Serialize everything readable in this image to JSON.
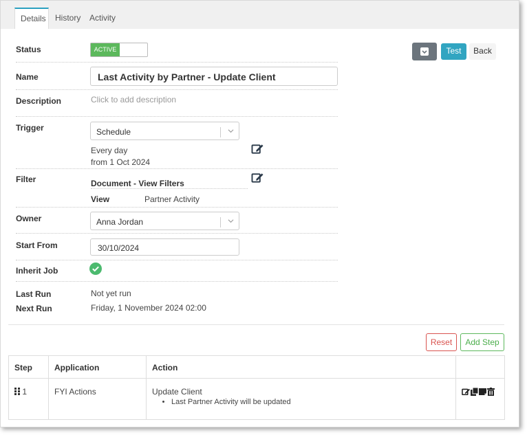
{
  "tabs": [
    {
      "label": "Details"
    },
    {
      "label": "History"
    },
    {
      "label": "Activity"
    }
  ],
  "fields": {
    "status": {
      "label": "Status",
      "toggle_text": "ACTIVE"
    },
    "name": {
      "label": "Name",
      "value": "Last Activity by Partner - Update Client"
    },
    "description": {
      "label": "Description",
      "placeholder": "Click to add description"
    },
    "trigger": {
      "label": "Trigger",
      "selected": "Schedule",
      "line1": "Every day",
      "line2": "from 1 Oct 2024"
    },
    "filter": {
      "label": "Filter",
      "heading": "Document - View Filters",
      "view_label": "View",
      "view_value": "Partner Activity"
    },
    "owner": {
      "label": "Owner",
      "selected": "Anna Jordan"
    },
    "start_from": {
      "label": "Start From",
      "value": "30/10/2024"
    },
    "inherit_job": {
      "label": "Inherit Job",
      "checked": true
    },
    "last_run": {
      "label": "Last Run",
      "value": "Not yet run"
    },
    "next_run": {
      "label": "Next Run",
      "value": "Friday, 1 November 2024 02:00"
    }
  },
  "actions": {
    "archive_icon": "archive-icon",
    "test_label": "Test",
    "back_label": "Back",
    "reset_label": "Reset",
    "add_step_label": "Add Step"
  },
  "steps_table": {
    "headers": [
      "Step",
      "Application",
      "Action"
    ],
    "rows": [
      {
        "step": "1",
        "application": "FYI Actions",
        "action": "Update Client",
        "detail": "Last Partner Activity will be updated"
      }
    ]
  },
  "colors": {
    "active_green": "#5cb85c",
    "test_blue": "#31a5c1",
    "reset_red": "#d9534f",
    "add_step_green": "#5cb85c",
    "check_green": "#4cba6f"
  }
}
